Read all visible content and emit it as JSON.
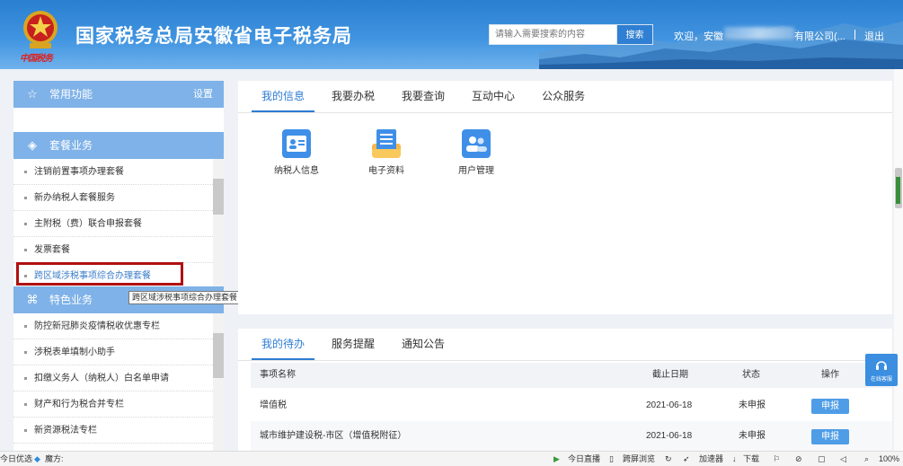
{
  "header": {
    "title": "国家税务总局安徽省电子税务局",
    "emblem_caption": "中国税务",
    "search_placeholder": "请输入需要搜索的内容",
    "search_button": "搜索",
    "welcome": "欢迎，安徽",
    "company": "有限公司(...",
    "logout": "退出"
  },
  "sidebar": {
    "common": {
      "label": "常用功能",
      "action": "设置"
    },
    "package": {
      "label": "套餐业务",
      "items": [
        {
          "label": "注销前置事项办理套餐"
        },
        {
          "label": "新办纳税人套餐服务"
        },
        {
          "label": "主附税（费）联合申报套餐"
        },
        {
          "label": "发票套餐"
        },
        {
          "label": "跨区域涉税事项综合办理套餐"
        }
      ]
    },
    "tooltip": "跨区域涉税事项综合办理套餐",
    "special": {
      "label": "特色业务",
      "items": [
        {
          "label": "防控新冠肺炎疫情税收优惠专栏"
        },
        {
          "label": "涉税表单填制小助手"
        },
        {
          "label": "扣缴义务人（纳税人）白名单申请"
        },
        {
          "label": "财产和行为税合并专栏"
        },
        {
          "label": "新资源税法专栏"
        }
      ]
    }
  },
  "main": {
    "tabs": [
      {
        "label": "我的信息"
      },
      {
        "label": "我要办税"
      },
      {
        "label": "我要查询"
      },
      {
        "label": "互动中心"
      },
      {
        "label": "公众服务"
      }
    ],
    "tiles": [
      {
        "label": "纳税人信息",
        "icon": "id-card-icon"
      },
      {
        "label": "电子资料",
        "icon": "document-folder-icon"
      },
      {
        "label": "用户管理",
        "icon": "users-icon"
      }
    ]
  },
  "todo": {
    "tabs": [
      {
        "label": "我的待办"
      },
      {
        "label": "服务提醒"
      },
      {
        "label": "通知公告"
      }
    ],
    "columns": [
      "事项名称",
      "截止日期",
      "状态",
      "操作"
    ],
    "rows": [
      {
        "name": "增值税",
        "deadline": "2021-06-18",
        "status": "未申报",
        "action": "申报"
      },
      {
        "name": "城市维护建设税-市区（增值税附征）",
        "deadline": "2021-06-18",
        "status": "未申报",
        "action": "申报"
      }
    ]
  },
  "online_service": "在线客服",
  "statusbar": {
    "left1": "今日优选",
    "left2": "魔方:",
    "live": "今日直播",
    "cross": "跨屏浏览",
    "accelerator": "加速器",
    "download": "下载",
    "zoom": "100%"
  },
  "colors": {
    "primary": "#2e7cd3",
    "sidebar_header": "#7fb2e8",
    "highlight_box": "#b01010",
    "button": "#4f9de6"
  }
}
